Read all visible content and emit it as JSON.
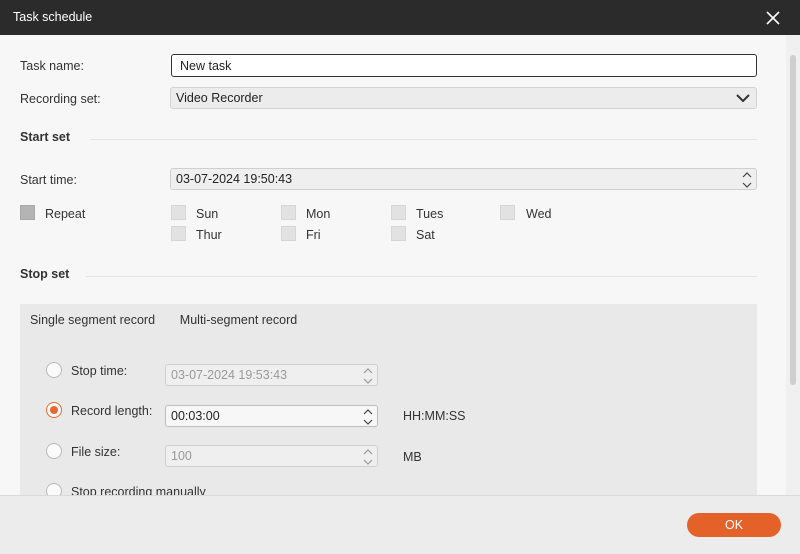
{
  "window": {
    "title": "Task schedule"
  },
  "form": {
    "task_name_label": "Task name:",
    "task_name_value": "New task",
    "recording_set_label": "Recording set:",
    "recording_set_value": "Video Recorder"
  },
  "start_set": {
    "heading": "Start set",
    "start_time_label": "Start time:",
    "start_time_value": "03-07-2024 19:50:43",
    "repeat_label": "Repeat",
    "days": [
      "Sun",
      "Mon",
      "Tues",
      "Wed",
      "Thur",
      "Fri",
      "Sat"
    ]
  },
  "stop_set": {
    "heading": "Stop set",
    "tabs": [
      {
        "label": "Single segment record",
        "active": true
      },
      {
        "label": "Multi-segment record",
        "active": false
      }
    ],
    "stop_time_label": "Stop time:",
    "stop_time_value": "03-07-2024 19:53:43",
    "record_length_label": "Record length:",
    "record_length_value": "00:03:00",
    "record_length_unit": "HH:MM:SS",
    "file_size_label": "File size:",
    "file_size_value": "100",
    "file_size_unit": "MB",
    "stop_manually_label": "Stop recording manually",
    "selected_option": "record_length"
  },
  "footer": {
    "ok_label": "OK"
  },
  "colors": {
    "accent": "#e4622a",
    "titlebar": "#2b2b2b"
  }
}
